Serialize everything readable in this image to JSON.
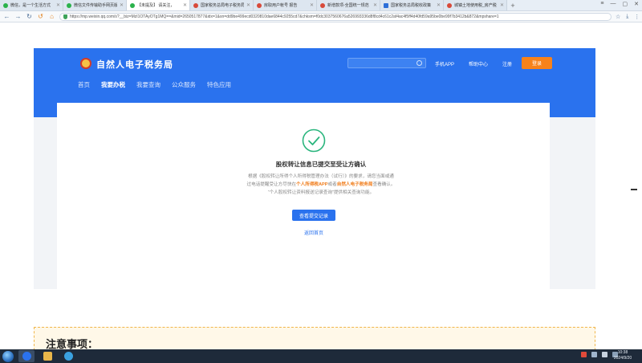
{
  "browser": {
    "tabs": [
      {
        "title": "微信，是一个生活方式",
        "favicon": "wechat-icon",
        "active": false
      },
      {
        "title": "微信文件传输助手网页版",
        "favicon": "wechat-icon",
        "active": false
      },
      {
        "title": "【未提及】 请关注，",
        "favicon": "wechat-icon",
        "active": true
      },
      {
        "title": "国家税务总局电子税务局",
        "favicon": "tax-bureau-icon",
        "active": false
      },
      {
        "title": "房取用户帐号 报告",
        "favicon": "tax-bureau-icon",
        "active": false
      },
      {
        "title": "新增款项-全国统一规范",
        "favicon": "tax-bureau-icon",
        "active": false
      },
      {
        "title": "国家税务总局税收政策",
        "favicon": "doc-icon",
        "active": false
      },
      {
        "title": "城镇土地使用税_房产税",
        "favicon": "tax-bureau-icon",
        "active": false
      }
    ],
    "url": "https://mp.weixin.qq.com/s?__biz=MzI1OTAyOTg1MQ==&mid=2650517877&idx=1&sn=dd9be499ecd0320810dae6844c9255cd7&chksm=f0dc3037560676a526993336d8f8cd4c61c2af4ac4f5ff4d40fd59a95be0be99f7b3412b&872&mpshare=1"
  },
  "header": {
    "site_name": "自然人电子税务局",
    "search_placeholder": "",
    "links": [
      "手机APP",
      "帮助中心",
      "注册"
    ],
    "login_label": "登录",
    "menu": [
      "首页",
      "我要办税",
      "我要查询",
      "公众服务",
      "特色应用"
    ],
    "active_menu": "我要办税"
  },
  "result": {
    "title": "股权转让信息已提交至受让方确认",
    "text_line1": "根据《股权转让所得个人所得税管理办法（试行）》的要求，请您当面或通",
    "text_line2_pre": "过电话提醒受让方尽快在",
    "text_line2_hl1": "个人所得税APP",
    "text_line2_mid": "或者",
    "text_line2_hl2": "自然人电子税务局",
    "text_line2_post": "查看确认。",
    "text_line3": "“个人股权转让资料报送记录查询”提供相关查询功能。",
    "primary_button": "查看提交记录",
    "back_link": "返回首页"
  },
  "notice": {
    "heading": "注意事项："
  },
  "taskbar": {
    "time": "10:38",
    "date": "2024/9/20"
  },
  "colors": {
    "brand_blue": "#2a72ee",
    "accent_orange": "#f7821a",
    "success_green": "#2ab57d"
  }
}
